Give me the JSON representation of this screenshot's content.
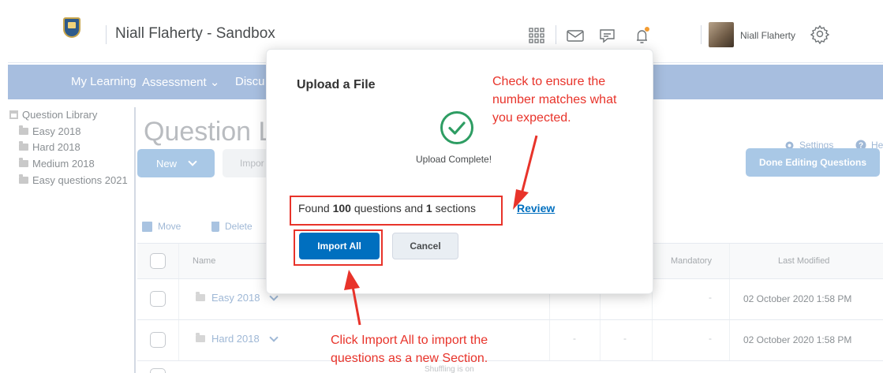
{
  "header": {
    "org_title": "Niall Flaherty - Sandbox",
    "user_name": "Niall Flaherty"
  },
  "nav": {
    "items": [
      "My Learning",
      "Assessment ⌄",
      "Discu"
    ]
  },
  "tree": {
    "root": "Question Library",
    "folders": [
      "Easy 2018",
      "Hard 2018",
      "Medium 2018",
      "Easy questions 2021"
    ]
  },
  "page": {
    "title": "Question L",
    "new_button": "New",
    "import_button": "Impor",
    "settings_link": "Settings",
    "help_link": "He",
    "done_button": "Done Editing Questions",
    "move_action": "Move",
    "delete_action": "Delete"
  },
  "table": {
    "headers": {
      "name": "Name",
      "mandatory": "Mandatory",
      "last_modified": "Last Modified"
    },
    "rows": [
      {
        "name": "Easy 2018",
        "dash": "-",
        "last_modified": "02 October 2020 1:58 PM"
      },
      {
        "name": "Hard 2018",
        "dash": "-",
        "last_modified": "02 October 2020 1:58 PM"
      }
    ],
    "peek_text": "Shuffling is on"
  },
  "modal": {
    "title": "Upload a File",
    "status": "Upload Complete!",
    "found_prefix": "Found",
    "question_count": "100",
    "found_middle": "questions and",
    "section_count": "1",
    "found_suffix": "sections",
    "review_link": "Review",
    "import_all_button": "Import All",
    "cancel_button": "Cancel"
  },
  "annotations": {
    "note_top": [
      "Check to ensure the",
      "number matches what",
      "you expected."
    ],
    "note_bottom": [
      "Click Import All to import the",
      "questions as a new Section."
    ],
    "color": "#e8332a"
  },
  "colors": {
    "primary": "#006fbf",
    "nav_bar": "#a7bedf",
    "success": "#2e9d63"
  }
}
